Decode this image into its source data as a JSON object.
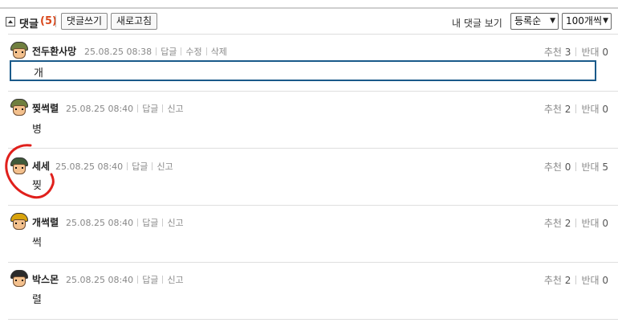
{
  "header": {
    "title": "댓글",
    "count": "(5)",
    "write_button": "댓글쓰기",
    "refresh_button": "새로고침",
    "my_comments_link": "내 댓글 보기",
    "sort_select": "등록순",
    "per_page_select": "100개씩"
  },
  "comments": [
    {
      "nick": "전두환사망",
      "date": "25.08.25 08:38",
      "actions": [
        "답글",
        "수정",
        "삭제"
      ],
      "up_label": "추천",
      "up": "3",
      "down_label": "반대",
      "down": "0",
      "text": "개",
      "editing": true
    },
    {
      "nick": "찢썩렬",
      "date": "25.08.25 08:40",
      "actions": [
        "답글",
        "신고"
      ],
      "up_label": "추천",
      "up": "2",
      "down_label": "반대",
      "down": "0",
      "text": "병"
    },
    {
      "nick": "세세",
      "date": "25.08.25 08:40",
      "actions": [
        "답글",
        "신고"
      ],
      "up_label": "추천",
      "up": "0",
      "down_label": "반대",
      "down": "5",
      "text": "찢"
    },
    {
      "nick": "개썩렬",
      "date": "25.08.25 08:40",
      "actions": [
        "답글",
        "신고"
      ],
      "up_label": "추천",
      "up": "2",
      "down_label": "반대",
      "down": "0",
      "text": "썩"
    },
    {
      "nick": "박스몬",
      "date": "25.08.25 08:40",
      "actions": [
        "답글",
        "신고"
      ],
      "up_label": "추천",
      "up": "2",
      "down_label": "반대",
      "down": "0",
      "text": "렬"
    }
  ],
  "colors": {
    "count": "#d9481c",
    "edit_border": "#1a5a8a",
    "annotation": "#e0201c"
  },
  "icons": {
    "collapse": "collapse-up-icon",
    "avatar": "soldier-avatar-icon",
    "select": "chevron-down-icon"
  }
}
